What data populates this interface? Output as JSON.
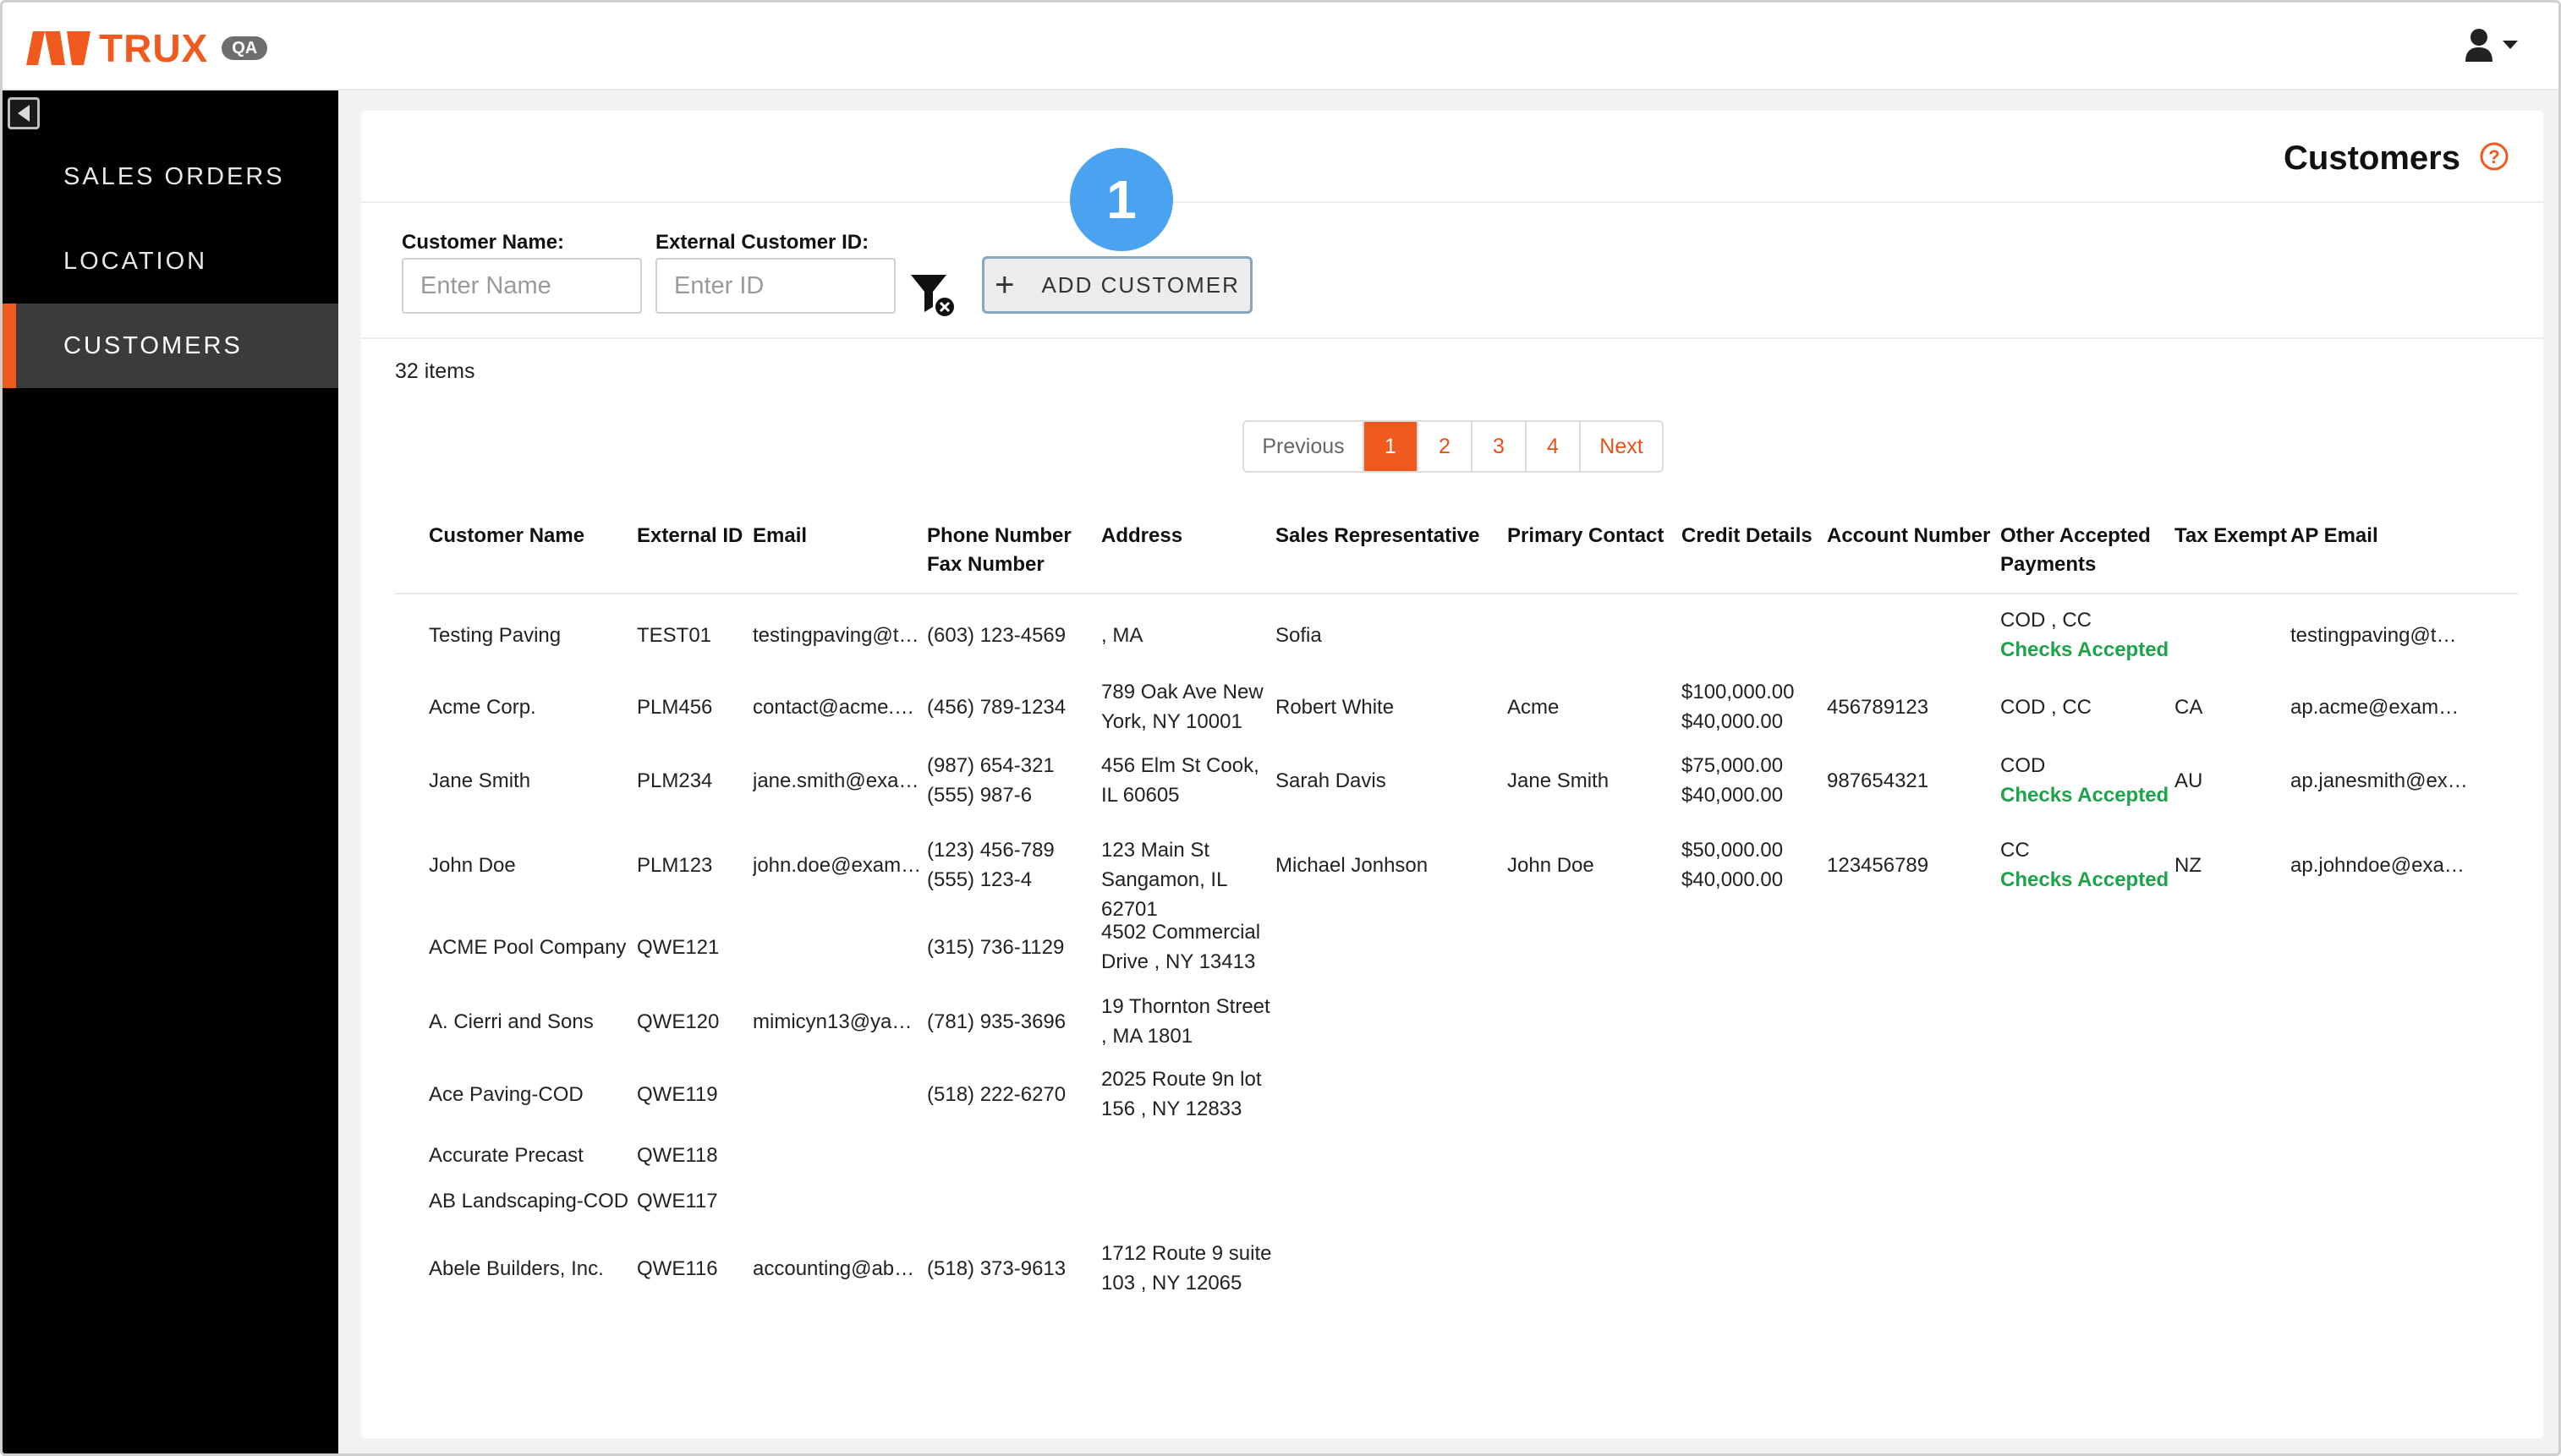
{
  "brand": {
    "name": "TRUX",
    "env_badge": "QA",
    "accent": "#f05a1e"
  },
  "sidebar": {
    "items": [
      {
        "label": "SALES ORDERS",
        "active": false
      },
      {
        "label": "LOCATION",
        "active": false
      },
      {
        "label": "CUSTOMERS",
        "active": true
      }
    ]
  },
  "page": {
    "title": "Customers"
  },
  "filters": {
    "customer_name_label": "Customer Name:",
    "customer_name_placeholder": "Enter Name",
    "external_id_label": "External Customer ID:",
    "external_id_placeholder": "Enter ID"
  },
  "add_button_label": "ADD CUSTOMER",
  "step_marker": "1",
  "items_count": "32 items",
  "pagination": {
    "previous": "Previous",
    "pages": [
      "1",
      "2",
      "3",
      "4"
    ],
    "current": "1",
    "next": "Next"
  },
  "table": {
    "headers": {
      "customer_name": "Customer Name",
      "external_id": "External ID",
      "email": "Email",
      "phone": "Phone Number",
      "fax": "Fax Number",
      "address": "Address",
      "sales_rep": "Sales Representative",
      "primary_contact": "Primary Contact",
      "credit_details": "Credit Details",
      "account_number": "Account Number",
      "other_payments_1": "Other Accepted",
      "other_payments_2": "Payments",
      "tax_exempt": "Tax Exempt",
      "ap_email": "AP Email"
    },
    "rows": [
      {
        "name": "Testing Paving",
        "ext_id": "TEST01",
        "email": "testingpaving@t…",
        "phone": "(603) 123-4569",
        "fax": "",
        "address": ", MA",
        "sales_rep": "Sofia",
        "contact": "",
        "credit1": "",
        "credit2": "",
        "account": "",
        "payments": "COD , CC",
        "checks": "Checks Accepted",
        "tax": "",
        "ap_email": "testingpaving@t…"
      },
      {
        "name": "Acme Corp.",
        "ext_id": "PLM456",
        "email": "contact@acme.c…",
        "phone": "(456) 789-1234",
        "fax": "",
        "address": "789 Oak Ave New York, NY 10001",
        "sales_rep": "Robert White",
        "contact": "Acme",
        "credit1": "$100,000.00",
        "credit2": "$40,000.00",
        "account": "456789123",
        "payments": "COD , CC",
        "checks": "",
        "tax": "CA",
        "ap_email": "ap.acme@exam…"
      },
      {
        "name": "Jane Smith",
        "ext_id": "PLM234",
        "email": "jane.smith@exa…",
        "phone": "(987) 654-321",
        "fax": "(555) 987-6",
        "address": "456 Elm St Cook, IL 60605",
        "sales_rep": "Sarah Davis",
        "contact": "Jane Smith",
        "credit1": "$75,000.00",
        "credit2": "$40,000.00",
        "account": "987654321",
        "payments": "COD",
        "checks": "Checks Accepted",
        "tax": "AU",
        "ap_email": "ap.janesmith@ex…"
      },
      {
        "name": "John Doe",
        "ext_id": "PLM123",
        "email": "john.doe@exam…",
        "phone": "(123) 456-789",
        "fax": "(555) 123-4",
        "address": "123 Main St Sangamon, IL 62701",
        "sales_rep": "Michael Jonhson",
        "contact": "John Doe",
        "credit1": "$50,000.00",
        "credit2": "$40,000.00",
        "account": "123456789",
        "payments": "CC",
        "checks": "Checks Accepted",
        "tax": "NZ",
        "ap_email": "ap.johndoe@exa…"
      },
      {
        "name": "ACME Pool Company",
        "ext_id": "QWE121",
        "email": "",
        "phone": "(315) 736-1129",
        "fax": "",
        "address": "4502 Commercial Drive , NY 13413",
        "sales_rep": "",
        "contact": "",
        "credit1": "",
        "credit2": "",
        "account": "",
        "payments": "",
        "checks": "",
        "tax": "",
        "ap_email": ""
      },
      {
        "name": "A. Cierri and Sons",
        "ext_id": "QWE120",
        "email": "mimicyn13@yah…",
        "phone": "(781) 935-3696",
        "fax": "",
        "address": "19 Thornton Street , MA 1801",
        "sales_rep": "",
        "contact": "",
        "credit1": "",
        "credit2": "",
        "account": "",
        "payments": "",
        "checks": "",
        "tax": "",
        "ap_email": ""
      },
      {
        "name": "Ace Paving-COD",
        "ext_id": "QWE119",
        "email": "",
        "phone": "(518) 222-6270",
        "fax": "",
        "address": "2025 Route 9n lot 156 , NY 12833",
        "sales_rep": "",
        "contact": "",
        "credit1": "",
        "credit2": "",
        "account": "",
        "payments": "",
        "checks": "",
        "tax": "",
        "ap_email": ""
      },
      {
        "name": "Accurate Precast",
        "ext_id": "QWE118",
        "email": "",
        "phone": "",
        "fax": "",
        "address": "",
        "sales_rep": "",
        "contact": "",
        "credit1": "",
        "credit2": "",
        "account": "",
        "payments": "",
        "checks": "",
        "tax": "",
        "ap_email": ""
      },
      {
        "name": "AB Landscaping-COD",
        "ext_id": "QWE117",
        "email": "",
        "phone": "",
        "fax": "",
        "address": "",
        "sales_rep": "",
        "contact": "",
        "credit1": "",
        "credit2": "",
        "account": "",
        "payments": "",
        "checks": "",
        "tax": "",
        "ap_email": ""
      },
      {
        "name": "Abele Builders, Inc.",
        "ext_id": "QWE116",
        "email": "accounting@abe…",
        "phone": "(518) 373-9613",
        "fax": "",
        "address": "1712 Route 9 suite 103 , NY 12065",
        "sales_rep": "",
        "contact": "",
        "credit1": "",
        "credit2": "",
        "account": "",
        "payments": "",
        "checks": "",
        "tax": "",
        "ap_email": ""
      }
    ]
  }
}
